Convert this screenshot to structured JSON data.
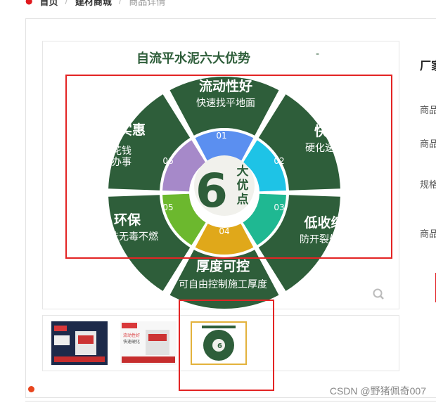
{
  "breadcrumb": {
    "home": "首页",
    "category": "建材商城",
    "current": "商品详情"
  },
  "main_image": {
    "title": "自流平水泥六大优势",
    "center_big": "6",
    "center_small_1": "大",
    "center_small_2": "优",
    "center_small_3": "点",
    "segments": [
      {
        "num": "01",
        "title": "流动性好",
        "desc": "快速找平地面",
        "color": "#5b8ff0"
      },
      {
        "num": "02",
        "title": "快凝",
        "desc": "硬化速度快",
        "color": "#1ec3e6"
      },
      {
        "num": "03",
        "title": "低收缩",
        "desc": "防开裂处理",
        "color": "#1fb892"
      },
      {
        "num": "04",
        "title": "厚度可控",
        "desc": "可自由控制施工厚度",
        "color": "#e0a81a"
      },
      {
        "num": "05",
        "title": "环保",
        "desc": "无味无毒不燃",
        "color": "#6cb82e"
      },
      {
        "num": "06",
        "title": "经济实惠",
        "desc_1": "少花钱",
        "desc_2": "多办事",
        "color": "#a689c9"
      }
    ]
  },
  "thumbnails": [
    {
      "label": "thumbnail-1"
    },
    {
      "label": "thumbnail-2",
      "text_1": "流动性好",
      "text_2": "快速硬化"
    },
    {
      "label": "thumbnail-3"
    }
  ],
  "info": {
    "factory_label": "厂家",
    "rows": [
      "商品",
      "商品",
      "规格",
      "商品"
    ]
  },
  "watermark": "CSDN @野猪佩奇007",
  "colors": {
    "dark_green": "#2e5e3a",
    "accent_red": "#e32424",
    "active_thumb_border": "#e3b23c"
  }
}
